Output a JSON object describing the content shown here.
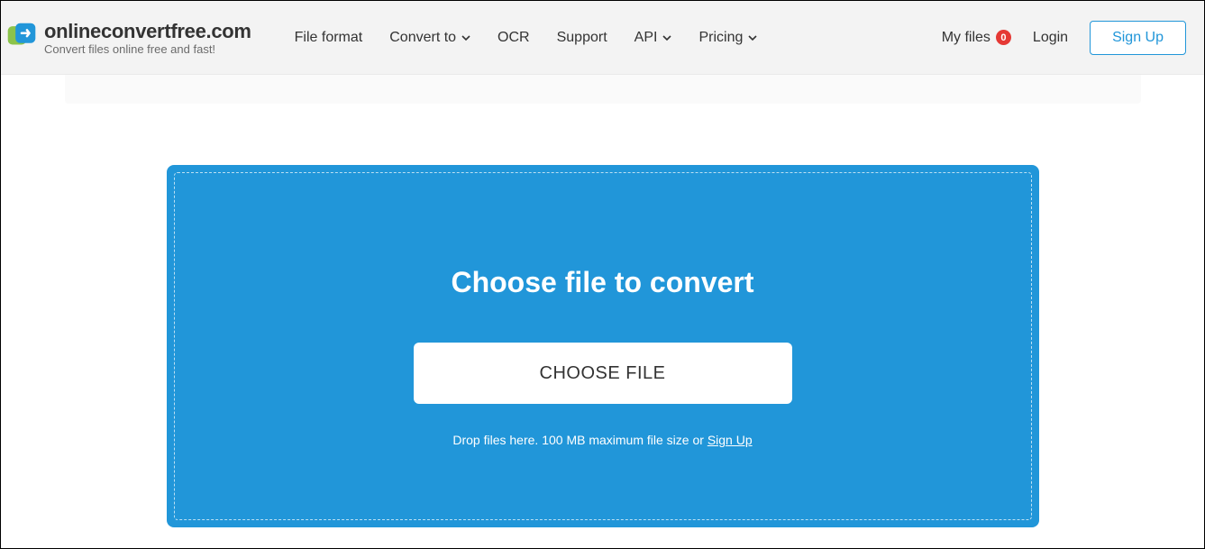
{
  "brand": {
    "site_name": "onlineconvertfree.com",
    "tagline": "Convert files online free and fast!"
  },
  "nav": {
    "file_format": "File format",
    "convert_to": "Convert to",
    "ocr": "OCR",
    "support": "Support",
    "api": "API",
    "pricing": "Pricing"
  },
  "header_right": {
    "my_files_label": "My files",
    "my_files_count": "0",
    "login": "Login",
    "signup": "Sign Up"
  },
  "dropzone": {
    "title": "Choose file to convert",
    "choose_button": "CHOOSE FILE",
    "note_prefix": "Drop files here. 100 MB maximum file size or ",
    "note_link": "Sign Up"
  },
  "colors": {
    "accent": "#2196d9",
    "badge": "#e53935",
    "header_bg": "#f3f3f3"
  }
}
